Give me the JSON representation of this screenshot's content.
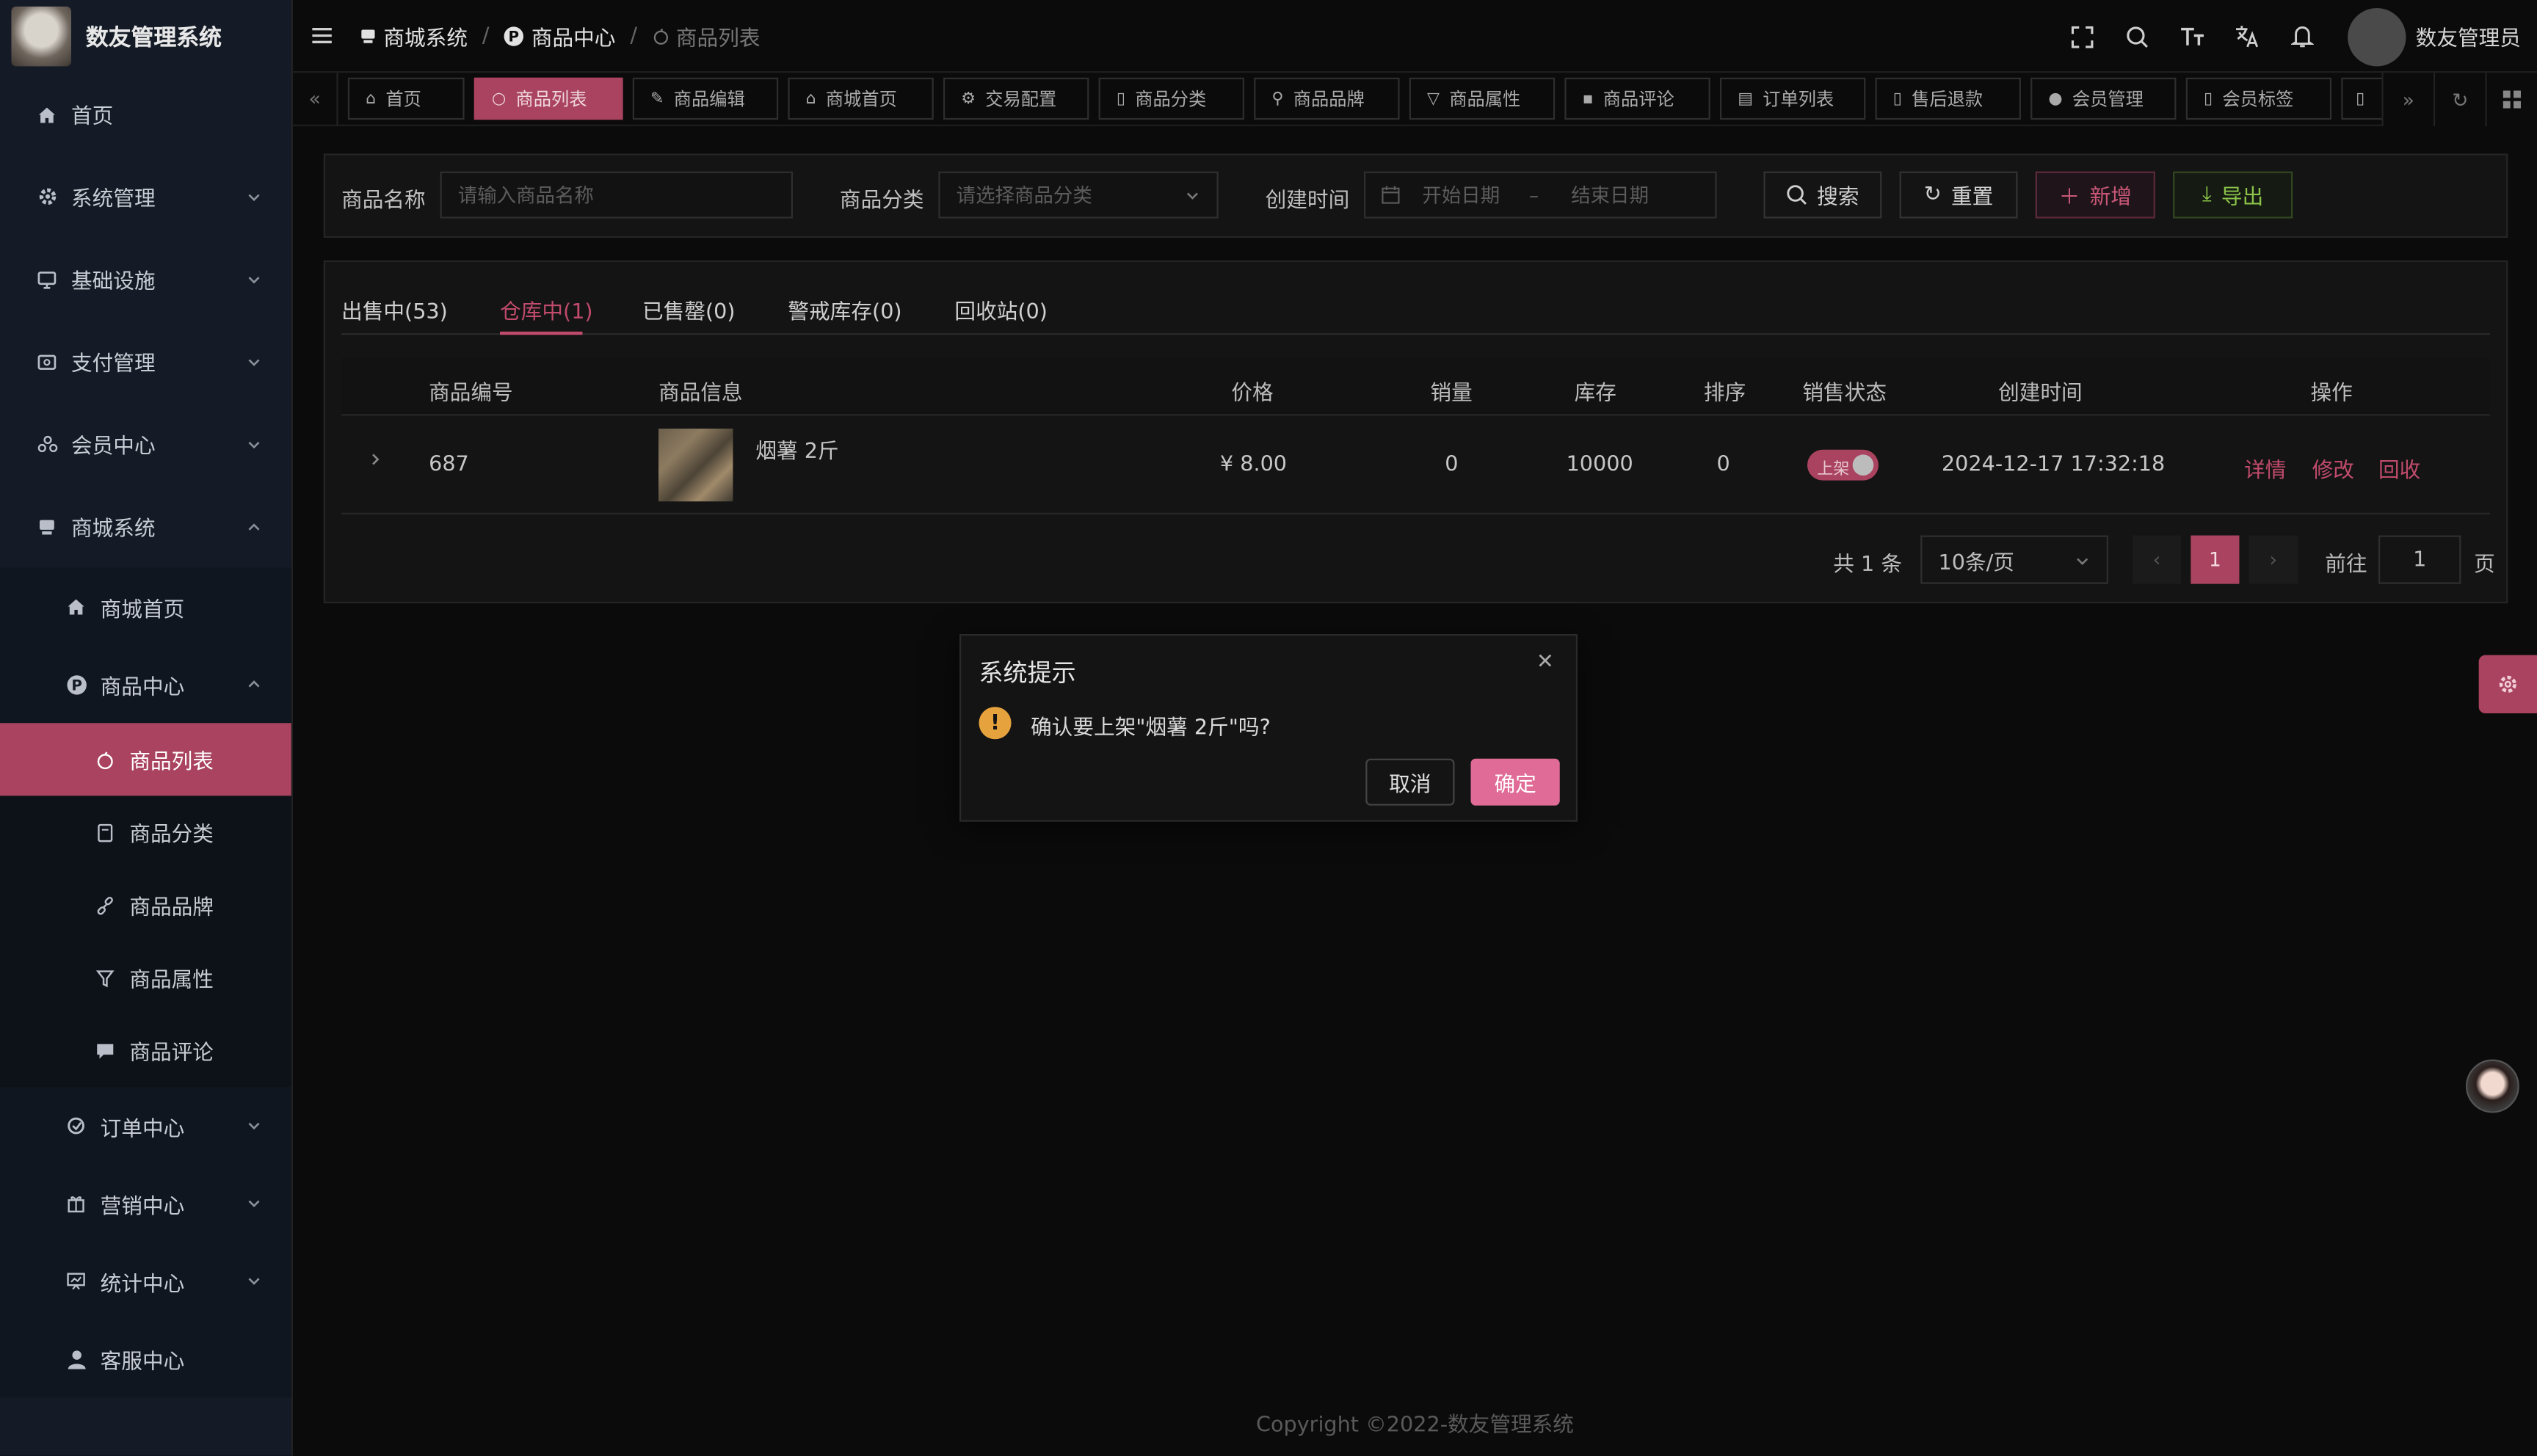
{
  "app": {
    "title": "数友管理系统"
  },
  "sidebar": {
    "items": [
      {
        "label": "首页",
        "icon": "home-icon"
      },
      {
        "label": "系统管理",
        "icon": "gear-icon"
      },
      {
        "label": "基础设施",
        "icon": "monitor-icon"
      },
      {
        "label": "支付管理",
        "icon": "wallet-icon"
      },
      {
        "label": "会员中心",
        "icon": "users-icon"
      },
      {
        "label": "商城系统",
        "icon": "shop-icon"
      }
    ],
    "mall_children": [
      {
        "label": "商城首页",
        "icon": "home-icon"
      },
      {
        "label": "商品中心",
        "icon": "product-center-icon"
      }
    ],
    "product_children": [
      {
        "label": "商品列表",
        "icon": "apple-icon"
      },
      {
        "label": "商品分类",
        "icon": "category-icon"
      },
      {
        "label": "商品品牌",
        "icon": "link-icon"
      },
      {
        "label": "商品属性",
        "icon": "filter-icon"
      },
      {
        "label": "商品评论",
        "icon": "comment-icon"
      }
    ],
    "more_children": [
      {
        "label": "订单中心",
        "icon": "order-icon"
      },
      {
        "label": "营销中心",
        "icon": "gift-icon"
      },
      {
        "label": "统计中心",
        "icon": "chart-icon"
      },
      {
        "label": "客服中心",
        "icon": "user-icon"
      }
    ]
  },
  "header": {
    "breadcrumb": [
      "商城系统",
      "商品中心",
      "商品列表"
    ],
    "user_name": "数友管理员"
  },
  "tags": [
    "首页",
    "商品列表",
    "商品编辑",
    "商城首页",
    "交易配置",
    "商品分类",
    "商品品牌",
    "商品属性",
    "商品评论",
    "订单列表",
    "售后退款",
    "会员管理",
    "会员标签"
  ],
  "filter": {
    "name_label": "商品名称",
    "name_placeholder": "请输入商品名称",
    "category_label": "商品分类",
    "category_placeholder": "请选择商品分类",
    "time_label": "创建时间",
    "start_placeholder": "开始日期",
    "range_sep": "–",
    "end_placeholder": "结束日期",
    "search": "搜索",
    "reset": "重置",
    "add": "新增",
    "export": "导出"
  },
  "tabs": [
    "出售中(53)",
    "仓库中(1)",
    "已售罄(0)",
    "警戒库存(0)",
    "回收站(0)"
  ],
  "table": {
    "headers": [
      "商品编号",
      "商品信息",
      "价格",
      "销量",
      "库存",
      "排序",
      "销售状态",
      "创建时间",
      "操作"
    ],
    "row": {
      "id": "687",
      "name": "烟薯 2斤",
      "price": "¥ 8.00",
      "sales": "0",
      "stock": "10000",
      "sort": "0",
      "status": "上架",
      "created": "2024-12-17 17:32:18",
      "actions": [
        "详情",
        "修改",
        "回收"
      ]
    }
  },
  "pager": {
    "total": "共 1 条",
    "page_size": "10条/页",
    "current": "1",
    "goto_label": "前往",
    "goto_value": "1",
    "page_unit": "页"
  },
  "dialog": {
    "title": "系统提示",
    "message": "确认要上架\"烟薯 2斤\"吗?",
    "cancel": "取消",
    "confirm": "确定"
  },
  "footer": {
    "copyright": "Copyright ©2022-数友管理系统"
  },
  "colors": {
    "accent": "#a9435f",
    "confirm": "#e06b96",
    "warning": "#e6a23c",
    "sidebar_bg": "#141b26"
  }
}
